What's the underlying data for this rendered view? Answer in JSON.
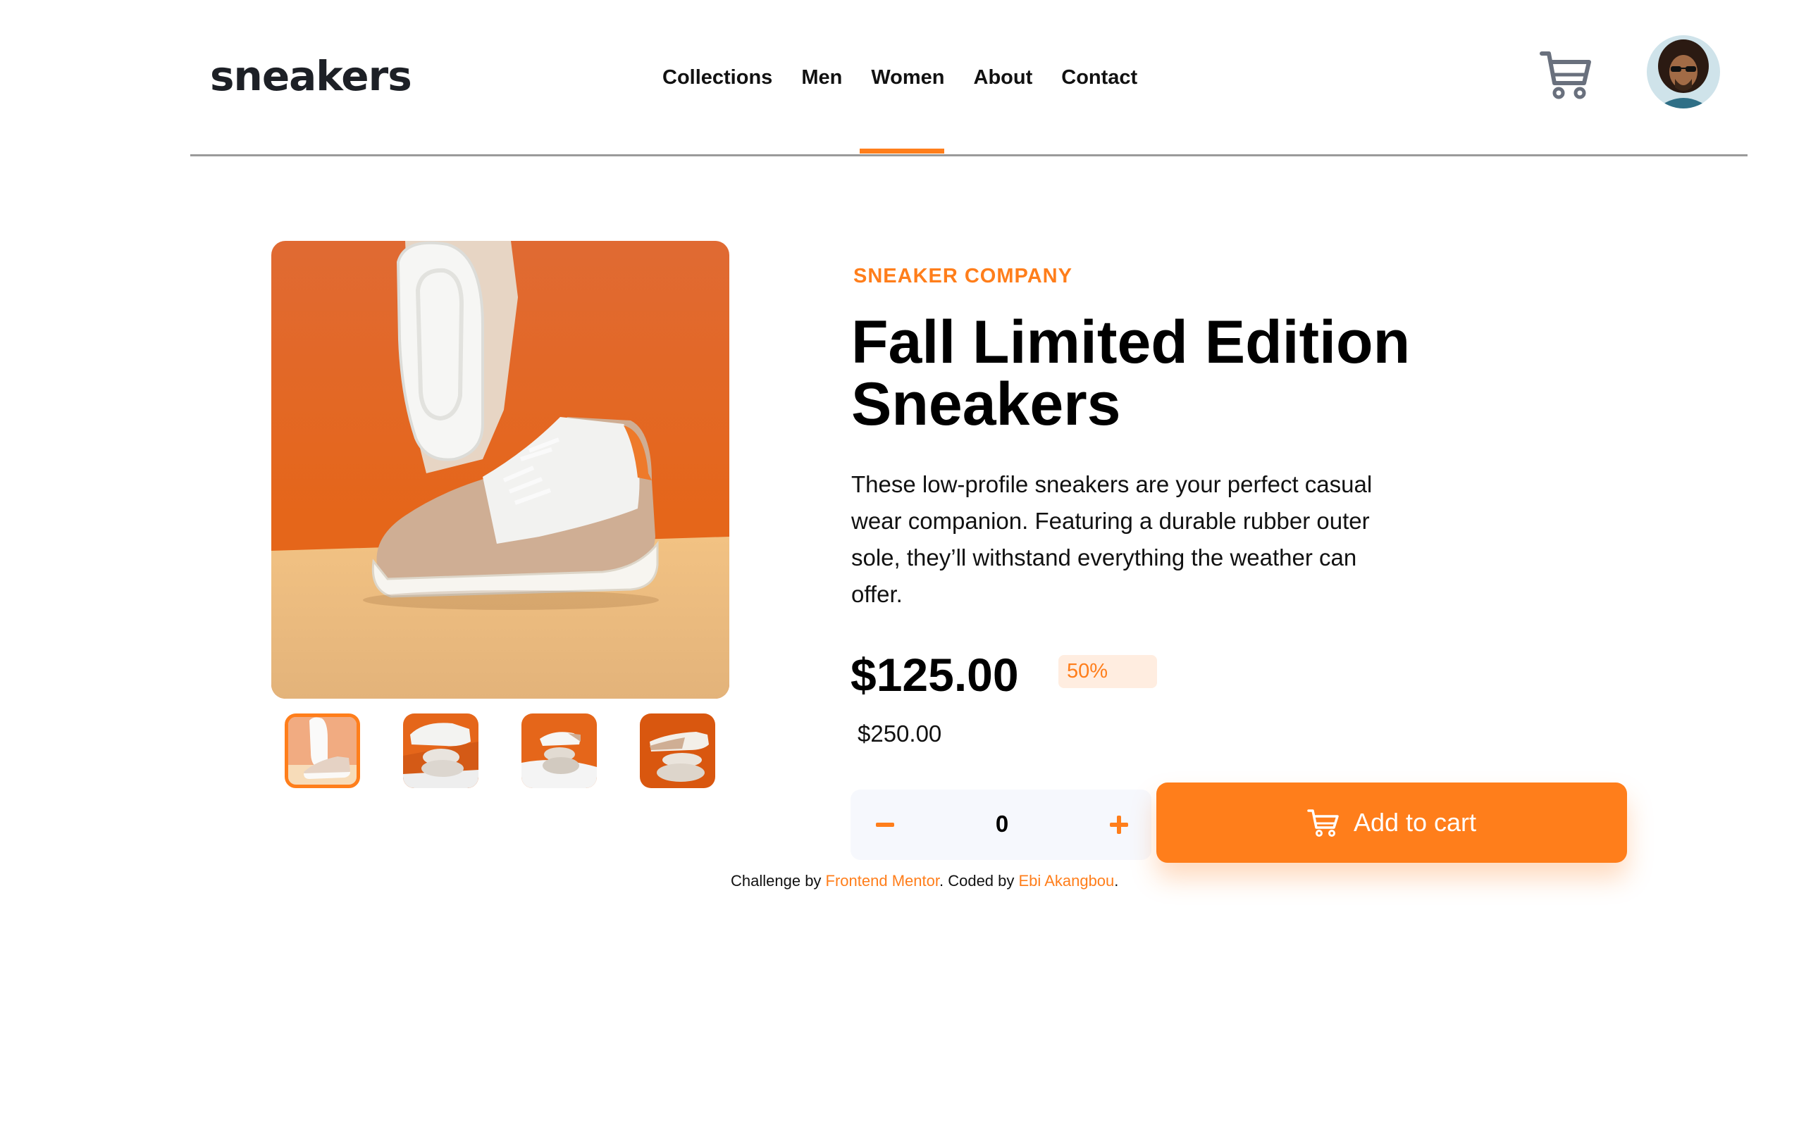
{
  "header": {
    "logo": "sneakers",
    "nav": [
      "Collections",
      "Men",
      "Women",
      "About",
      "Contact"
    ],
    "active_nav": "Contact",
    "cart_icon": "cart-icon",
    "avatar_icon": "user-avatar"
  },
  "gallery": {
    "main_image": "sneaker-photo",
    "thumbnails": [
      "thumbnail-1",
      "thumbnail-2",
      "thumbnail-3",
      "thumbnail-4"
    ],
    "active_thumbnail": 1
  },
  "product": {
    "company": "SNEAKER COMPANY",
    "title": "Fall Limited Edition Sneakers",
    "description": "These low-profile sneakers are your perfect casual wear companion. Featuring a durable rubber outer sole, they’ll withstand everything the weather can offer.",
    "price": "$125.00",
    "discount": "50%",
    "original_price": "$250.00"
  },
  "cart_controls": {
    "quantity": "0",
    "minus_icon": "minus-icon",
    "plus_icon": "plus-icon",
    "add_label": "Add to cart"
  },
  "attribution": {
    "prefix": "Challenge by ",
    "challenge_link": "Frontend Mentor",
    "middle": ". Coded by ",
    "author_link": "Ebi Akangbou",
    "suffix": "."
  },
  "colors": {
    "accent": "#ff7e1b",
    "accent_pale": "#ffede0",
    "text_dark": "#1d2026",
    "qty_bg": "#f6f8fd"
  }
}
